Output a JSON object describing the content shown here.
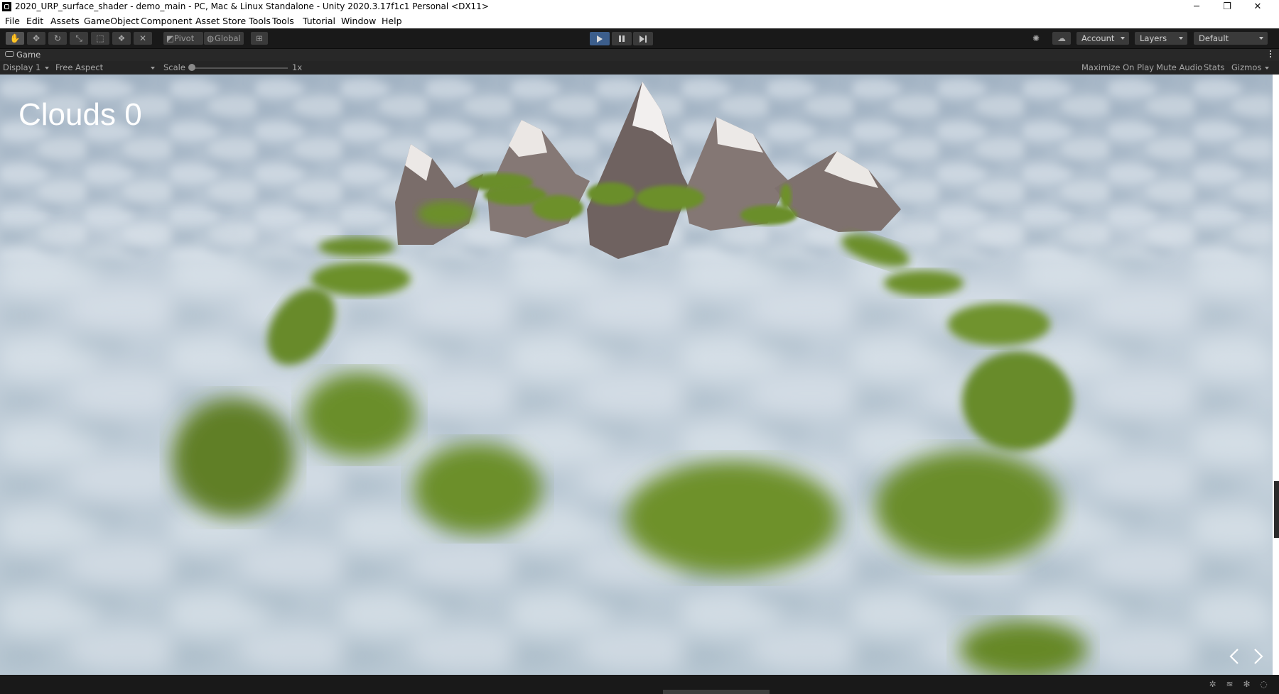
{
  "window": {
    "title": "2020_URP_surface_shader - demo_main - PC, Mac & Linux Standalone - Unity 2020.3.17f1c1 Personal <DX11>",
    "controls": {
      "minimize": "─",
      "restore": "❐",
      "close": "✕"
    }
  },
  "menu": {
    "items": [
      "File",
      "Edit",
      "Assets",
      "GameObject",
      "Component",
      "Asset Store Tools",
      "Tools",
      "Tutorial",
      "Window",
      "Help"
    ]
  },
  "toolbar": {
    "tools": [
      {
        "name": "hand-tool",
        "icon": "hand-icon",
        "glyph": "✋"
      },
      {
        "name": "move-tool",
        "icon": "move-icon",
        "glyph": "✥"
      },
      {
        "name": "rotate-tool",
        "icon": "rotate-icon",
        "glyph": "↻"
      },
      {
        "name": "scale-tool",
        "icon": "scale-icon",
        "glyph": "⤡"
      },
      {
        "name": "rect-tool",
        "icon": "rect-icon",
        "glyph": "⬚"
      },
      {
        "name": "transform-tool",
        "icon": "transform-icon",
        "glyph": "❖"
      },
      {
        "name": "custom-tool",
        "icon": "tools-icon",
        "glyph": "✕"
      }
    ],
    "pivot_label": "Pivot",
    "global_label": "Global",
    "grid_glyph": "⊞",
    "account_label": "Account",
    "layers_label": "Layers",
    "layout_label": "Default",
    "play_active": true
  },
  "game_tab": {
    "label": "Game"
  },
  "game_bar": {
    "display": "Display 1",
    "aspect": "Free Aspect",
    "scale_label": "Scale",
    "scale_value": "1x",
    "maximize_on_play": "Maximize On Play",
    "mute_audio": "Mute Audio",
    "stats": "Stats",
    "gizmos": "Gizmos"
  },
  "hud": {
    "score_text": "Clouds 0"
  },
  "colors": {
    "play_active": "#3c5e8c",
    "cloud_base": "#bcc9d4",
    "island_green": "#6b8f2a",
    "mountain": "#7d716d",
    "snow": "#e9e6e4"
  }
}
